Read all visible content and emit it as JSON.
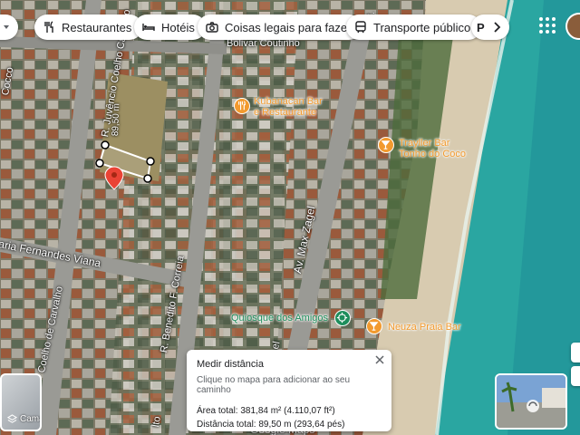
{
  "chips": {
    "restaurants": "Restaurantes",
    "hotels": "Hotéis",
    "things_to_do": "Coisas legais para fazer",
    "transit": "Transporte público",
    "next_partial": "P"
  },
  "places": {
    "kubanacan": "Kubanacan Bar\ne Restaurante",
    "trayller": "Trayller Bar\nTonho do Coco",
    "quiosque": "Quiosque dos Amigos",
    "neuza": "Neuza Praia Bar",
    "bolivar": "Bolivar Coutinho"
  },
  "streets": {
    "juvencio": "R. Juvêncio Coelho Carvalho",
    "max_zagel": "Av. Max Zagel",
    "benedito": "R. Benedito F. Correia",
    "maria": "aria Fernandes Viana",
    "coelho": "Coelho de Carvalho",
    "cocco": "Cocco",
    "r_upper": "R.",
    "r_top": "R.",
    "el": "el",
    "lto": "lto"
  },
  "measure": {
    "distance_label": "89,50 m"
  },
  "dialog": {
    "title": "Medir distância",
    "hint": "Clique no mapa para adicionar ao seu caminho",
    "area": "Área total: 381,84 m² (4.110,07 ft²)",
    "distance": "Distância total: 89,50 m (293,64 pés)"
  },
  "layers": {
    "label": "Camadas"
  },
  "watermark": "Google Maps",
  "colors": {
    "ocean": "#2aa6a1",
    "sand": "#d8cbb0",
    "pin_red": "#ea4335",
    "poi_orange": "#f29a2e",
    "poi_green": "#1e8e5c"
  }
}
